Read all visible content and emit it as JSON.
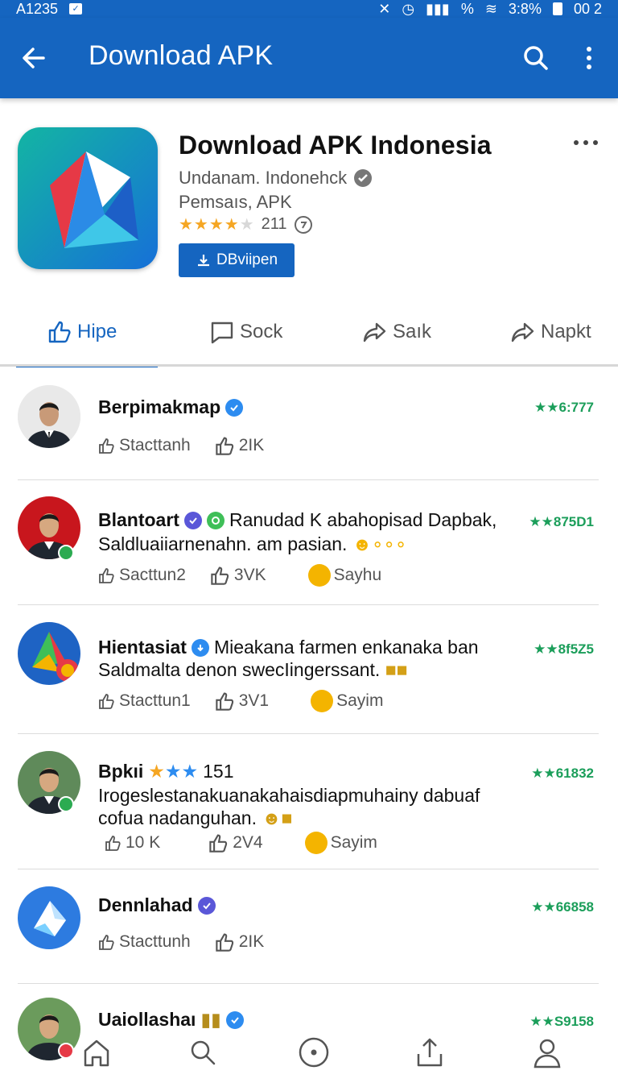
{
  "status_bar": {
    "time": "A1235",
    "network": "%",
    "battery_text": "3:8%",
    "clock": "00 2"
  },
  "app_bar": {
    "title": "Download APK"
  },
  "app": {
    "name": "Download APK Indonesia",
    "developer": "Undanam. Indonehck",
    "category": "Pemsaıs, APK",
    "rating": 4,
    "rating_count": "211",
    "install_label": "DBviipen",
    "colors": {
      "primary": "#1565c0",
      "accent_green": "#1b9e5a",
      "star": "#f5a623"
    }
  },
  "tabs": [
    {
      "label": "Hipe",
      "icon": "thumbs-up-icon",
      "active": true
    },
    {
      "label": "Sock",
      "icon": "comment-icon",
      "active": false
    },
    {
      "label": "Saık",
      "icon": "share-icon",
      "active": false
    },
    {
      "label": "Napkt",
      "icon": "share-icon",
      "active": false
    }
  ],
  "feed": [
    {
      "name": "Berpimakmap",
      "text": "",
      "text2": "",
      "score": "★★6:777",
      "likes_label": "Stacttanh",
      "count": "2IK",
      "reaction": ""
    },
    {
      "name": "Blantoart",
      "inline": "Ranudad K abahopisad Dapbak,",
      "text": "Saldluaiiarnenahn. am pasian.",
      "score": "★★875D1",
      "likes_label": "Sacttun2",
      "count": "3VK",
      "reaction": "Sayhu"
    },
    {
      "name": "Hientasiat",
      "inline": "Mieakana farmen enkanaka ban",
      "text": "Saldmalta denon swecIingerssant.",
      "score": "★★8f5Z5",
      "likes_label": "Stacttun1",
      "count": "3V1",
      "reaction": "Sayim"
    },
    {
      "name": "Bpkıi",
      "inline": "151",
      "text": "Irogeslestanakuanakahaisdiapmuhainy dabuaf",
      "text2": "cofua nadanguhan.",
      "score": "★★61832",
      "likes_label": "10 K",
      "count": "2V4",
      "reaction": "Sayim"
    },
    {
      "name": "Dennlahad",
      "text": "",
      "score": "★★66858",
      "likes_label": "Stacttunh",
      "count": "2IK",
      "reaction": ""
    },
    {
      "name": "Uaiollashaı",
      "text": "",
      "score": "★★S9158"
    }
  ],
  "bottom_nav": [
    "home-icon",
    "search-icon",
    "compass-icon",
    "share-upload-icon",
    "profile-icon"
  ]
}
